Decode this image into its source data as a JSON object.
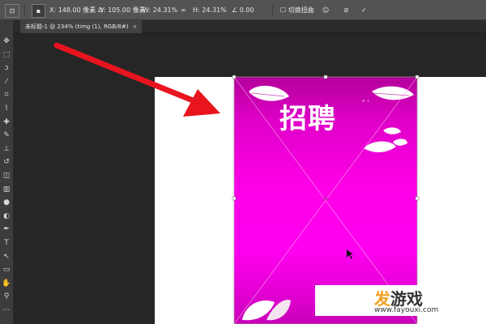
{
  "options_bar": {
    "tool_icon": "transform-tool-icon",
    "x_label": "X:",
    "x_value": "148.00 像素",
    "delta_icon": "Δ",
    "y_label": "Y:",
    "y_value": "105.00 像素",
    "w_label": "W:",
    "w_value": "24.31%",
    "link_icon": "∞",
    "h_label": "H:",
    "h_value": "24.31%",
    "angle_icon": "∠",
    "angle_value": "0.00",
    "warp_label": "切换扭曲",
    "interpolation_icon": "☺",
    "cancel_icon": "⊘",
    "commit_icon": "✓"
  },
  "document_tab": {
    "title": "未标题-1 @ 234% (timg (1), RGB/8#)",
    "close": "×"
  },
  "toolbar": {
    "tools": [
      {
        "icon": "✥",
        "name": "move-tool-icon"
      },
      {
        "icon": "⬚",
        "name": "marquee-tool-icon"
      },
      {
        "icon": "ↄ",
        "name": "lasso-tool-icon"
      },
      {
        "icon": "⁄",
        "name": "quick-select-tool-icon"
      },
      {
        "icon": "⌗",
        "name": "crop-tool-icon"
      },
      {
        "icon": "⌇",
        "name": "eyedropper-tool-icon"
      },
      {
        "icon": "✚",
        "name": "healing-tool-icon"
      },
      {
        "icon": "✎",
        "name": "brush-tool-icon"
      },
      {
        "icon": "⊥",
        "name": "clone-stamp-tool-icon"
      },
      {
        "icon": "↺",
        "name": "history-brush-tool-icon"
      },
      {
        "icon": "◫",
        "name": "eraser-tool-icon"
      },
      {
        "icon": "▥",
        "name": "gradient-tool-icon"
      },
      {
        "icon": "●",
        "name": "blur-tool-icon"
      },
      {
        "icon": "◐",
        "name": "dodge-tool-icon"
      },
      {
        "icon": "✒",
        "name": "pen-tool-icon"
      },
      {
        "icon": "T",
        "name": "type-tool-icon"
      },
      {
        "icon": "↖",
        "name": "path-select-tool-icon"
      },
      {
        "icon": "▭",
        "name": "shape-tool-icon"
      },
      {
        "icon": "✋",
        "name": "hand-tool-icon"
      },
      {
        "icon": "⚲",
        "name": "zoom-tool-icon"
      },
      {
        "icon": "⋯",
        "name": "more-tools-icon"
      }
    ]
  },
  "canvas": {
    "poster_title": "招聘",
    "poster_ornament": "ʺ ʹ"
  },
  "watermark": {
    "brand_part1": "发",
    "brand_part2": "游戏",
    "url": "www.fayouxi.com"
  },
  "colors": {
    "arrow": "#e8141e",
    "poster_magenta": "#ff00e8"
  }
}
